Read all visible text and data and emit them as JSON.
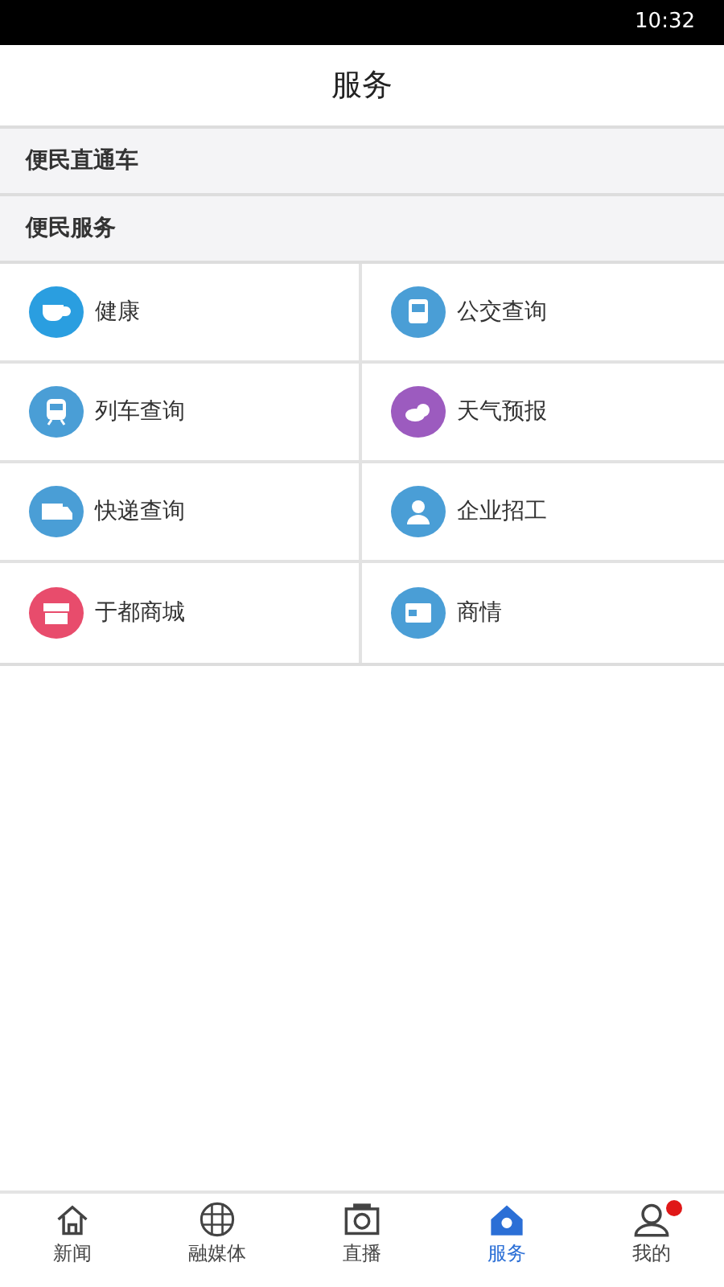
{
  "status_bar": {
    "time": "10:32"
  },
  "header": {
    "title": "服务"
  },
  "sections": [
    {
      "label": "便民直通车"
    },
    {
      "label": "便民服务"
    }
  ],
  "services": [
    {
      "label": "健康",
      "kind": "cup",
      "color": "#2a9ee0"
    },
    {
      "label": "公交查询",
      "kind": "bus",
      "color": "#4a9ed6"
    },
    {
      "label": "列车查询",
      "kind": "train",
      "color": "#4a9ed6"
    },
    {
      "label": "天气预报",
      "kind": "cloud",
      "color": "#9c5bbf"
    },
    {
      "label": "快递查询",
      "kind": "truck",
      "color": "#4a9ed6"
    },
    {
      "label": "企业招工",
      "kind": "person",
      "color": "#4a9ed6"
    },
    {
      "label": "于都商城",
      "kind": "shop",
      "color": "#e84c6c"
    },
    {
      "label": "商情",
      "kind": "card",
      "color": "#4a9ed6"
    }
  ],
  "tab_bar": [
    {
      "label": "新闻",
      "kind": "home",
      "selected": false,
      "badge": false
    },
    {
      "label": "融媒体",
      "kind": "globe",
      "selected": false,
      "badge": false
    },
    {
      "label": "直播",
      "kind": "camera",
      "selected": false,
      "badge": false
    },
    {
      "label": "服务",
      "kind": "service",
      "selected": true,
      "badge": false
    },
    {
      "label": "我的",
      "kind": "user",
      "selected": false,
      "badge": true
    }
  ]
}
